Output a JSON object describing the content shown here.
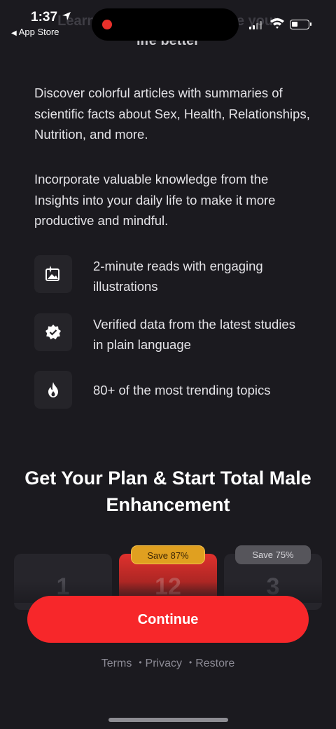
{
  "status_bar": {
    "time": "1:37",
    "back_label": "App Store"
  },
  "ghost_title": "Learn secrets that will make your",
  "ghost_title_line2": "life better",
  "paragraphs": [
    "Discover colorful articles with summaries of scientific facts about Sex, Health, Relationships, Nutrition, and more.",
    "Incorporate valuable knowledge from the Insights into your daily life to make it more productive and mindful."
  ],
  "features": [
    {
      "icon": "image-sparkle-icon",
      "text": "2-minute reads with engaging illustrations"
    },
    {
      "icon": "verified-badge-icon",
      "text": "Verified data from the latest studies in plain language"
    },
    {
      "icon": "fire-icon",
      "text": "80+ of the most trending topics"
    }
  ],
  "headline": "Get Your Plan & Start Total Male Enhancement",
  "plans": [
    {
      "number": "1",
      "badge": ""
    },
    {
      "number": "12",
      "badge": "Save 87%",
      "selected": true
    },
    {
      "number": "3",
      "badge": "Save 75%"
    }
  ],
  "continue_label": "Continue",
  "links": {
    "terms": "Terms",
    "privacy": "Privacy",
    "restore": "Restore"
  },
  "colors": {
    "background": "#1b1a1f",
    "accent": "#f7272a",
    "badge_gold": "#e0a020"
  }
}
